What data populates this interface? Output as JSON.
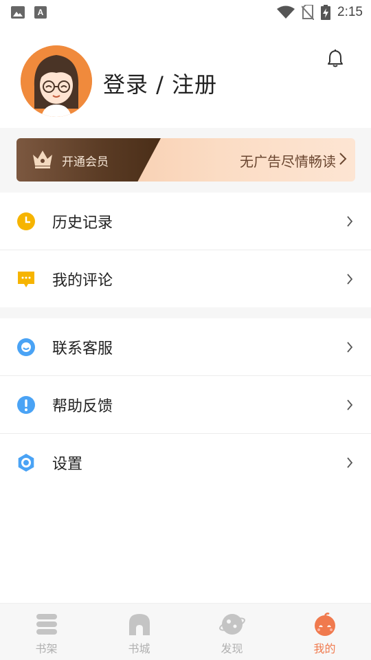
{
  "status_bar": {
    "time": "2:15",
    "left_icons": [
      "image-icon",
      "font-icon"
    ],
    "right_icons": [
      "wifi-icon",
      "no-sim-icon",
      "battery-charging-icon"
    ]
  },
  "profile": {
    "login_text": "登录 / 注册"
  },
  "vip": {
    "label": "开通会员",
    "promo": "无广告尽情畅读"
  },
  "menu_group1": [
    {
      "label": "历史记录",
      "icon": "clock-icon",
      "color": "#f6b400"
    },
    {
      "label": "我的评论",
      "icon": "comment-icon",
      "color": "#f6b400"
    }
  ],
  "menu_group2": [
    {
      "label": "联系客服",
      "icon": "customer-service-icon",
      "color": "#4aa3f5"
    },
    {
      "label": "帮助反馈",
      "icon": "exclamation-icon",
      "color": "#4aa3f5"
    },
    {
      "label": "设置",
      "icon": "settings-icon",
      "color": "#4aa3f5"
    }
  ],
  "tabs": [
    {
      "label": "书架",
      "icon": "bookshelf-icon",
      "active": false
    },
    {
      "label": "书城",
      "icon": "bookstore-icon",
      "active": false
    },
    {
      "label": "发现",
      "icon": "discover-icon",
      "active": false
    },
    {
      "label": "我的",
      "icon": "mine-icon",
      "active": true
    }
  ],
  "colors": {
    "accent": "#f07a4e",
    "inactive_tab": "#b0b0b0",
    "vip_dark": "#5a3b24",
    "vip_light": "#fbdcc4"
  }
}
